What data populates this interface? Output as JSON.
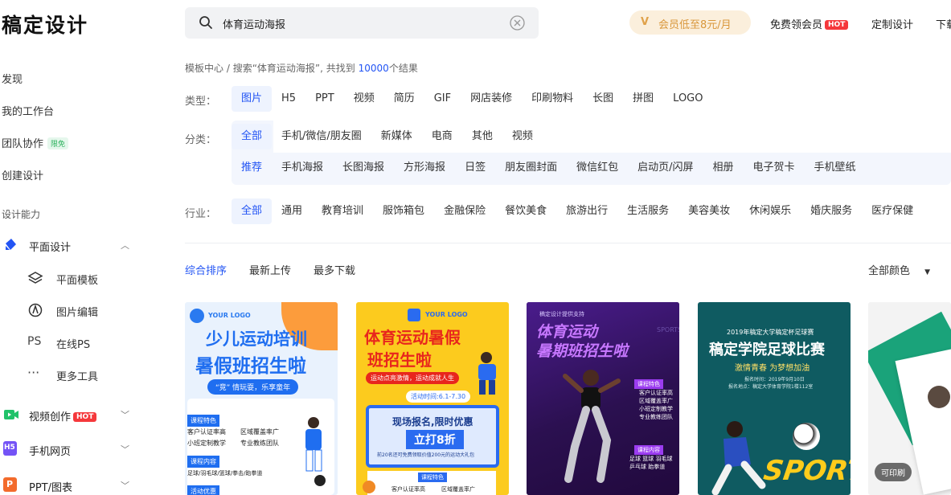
{
  "header": {
    "logo": "稿定设计",
    "search_value": "体育运动海报",
    "vip_label": "会员低至8元/月",
    "free_vip": "免费领会员",
    "hot": "HOT",
    "custom_design": "定制设计",
    "download": "下载"
  },
  "sidebar": {
    "discover": "发现",
    "workspace": "我的工作台",
    "team": "团队协作",
    "team_badge": "限免",
    "create": "创建设计",
    "section": "设计能力",
    "graphic": "平面设计",
    "graphic_template": "平面模板",
    "image_edit": "图片编辑",
    "ps_icon": "PS",
    "online_ps": "在线PS",
    "more_tools": "更多工具",
    "video": "视频创作",
    "video_hot": "HOT",
    "h5_icon": "H5",
    "mobile_web": "手机网页",
    "ppt_icon": "P",
    "ppt": "PPT/图表"
  },
  "breadcrumb": {
    "root": "模板中心",
    "sep": "/",
    "prefix": "搜索“体育运动海报”, 共找到",
    "count": "10000",
    "suffix": "个结果"
  },
  "filters": {
    "type_label": "类型：",
    "types": [
      "图片",
      "H5",
      "PPT",
      "视频",
      "简历",
      "GIF",
      "网店装修",
      "印刷物料",
      "长图",
      "拼图",
      "LOGO"
    ],
    "category_label": "分类：",
    "categories": [
      "全部",
      "手机/微信/朋友圈",
      "新媒体",
      "电商",
      "其他",
      "视频"
    ],
    "subcategories": [
      "推荐",
      "手机海报",
      "长图海报",
      "方形海报",
      "日签",
      "朋友圈封面",
      "微信红包",
      "启动页/闪屏",
      "相册",
      "电子贺卡",
      "手机壁纸"
    ],
    "industry_label": "行业：",
    "industries": [
      "全部",
      "通用",
      "教育培训",
      "服饰箱包",
      "金融保险",
      "餐饮美食",
      "旅游出行",
      "生活服务",
      "美容美妆",
      "休闲娱乐",
      "婚庆服务",
      "医疗保健"
    ]
  },
  "sort": {
    "comprehensive": "综合排序",
    "latest": "最新上传",
    "most_downloaded": "最多下载",
    "all_colors": "全部颜色"
  },
  "cards": [
    {
      "logo": "YOUR LOGO",
      "title_line1": "少儿运动培训",
      "title_line2": "暑假班招生啦",
      "slogan": "“竞” 情玩耍，乐享童年",
      "section1": "课程特色",
      "features": [
        "客户认证率高",
        "区域覆盖率广",
        "小班定制教学",
        "专业教练团队"
      ],
      "section2": "课程内容",
      "courses": "足球/羽毛球/篮球/拳击/跆拳道",
      "section3": "活动优惠"
    },
    {
      "logo": "YOUR LOGO",
      "title_line1": "体育运动暑假",
      "title_line2": "班招生啦",
      "tagline": "运动点亮激情，运动成就人生",
      "dates": "活动时间:6.1-7.30",
      "offer": "现场报名,限时优惠",
      "discount": "立打8折",
      "note": "前20名还可免费领取价值200元的运动大礼包",
      "course": "课程特色",
      "features": [
        "客户认证率高",
        "区域覆盖率广"
      ]
    },
    {
      "top": "稿定设计提供支持",
      "title_line1": "体育运动",
      "title_line2": "暑期班招生啦",
      "side": "SPORTS",
      "badge1": "课程特色",
      "list1": [
        "客户认证率高",
        "区域覆盖率广",
        "小班定制教学",
        "专业教练团队"
      ],
      "badge2": "课程内容",
      "list2": [
        "足球 篮球 羽毛球",
        "乒乓球 跆拳道"
      ]
    },
    {
      "top": "2019年稿定大学稿定杯足球赛",
      "title": "稿定学院足球比赛",
      "slogan": "激情青春 为梦想加油",
      "time": "报名时间：2019年9月10日",
      "place": "报名地点：稿定大学体育学院1楼112室",
      "sport": "SPORT"
    },
    {
      "print_label": "可印刷"
    }
  ]
}
